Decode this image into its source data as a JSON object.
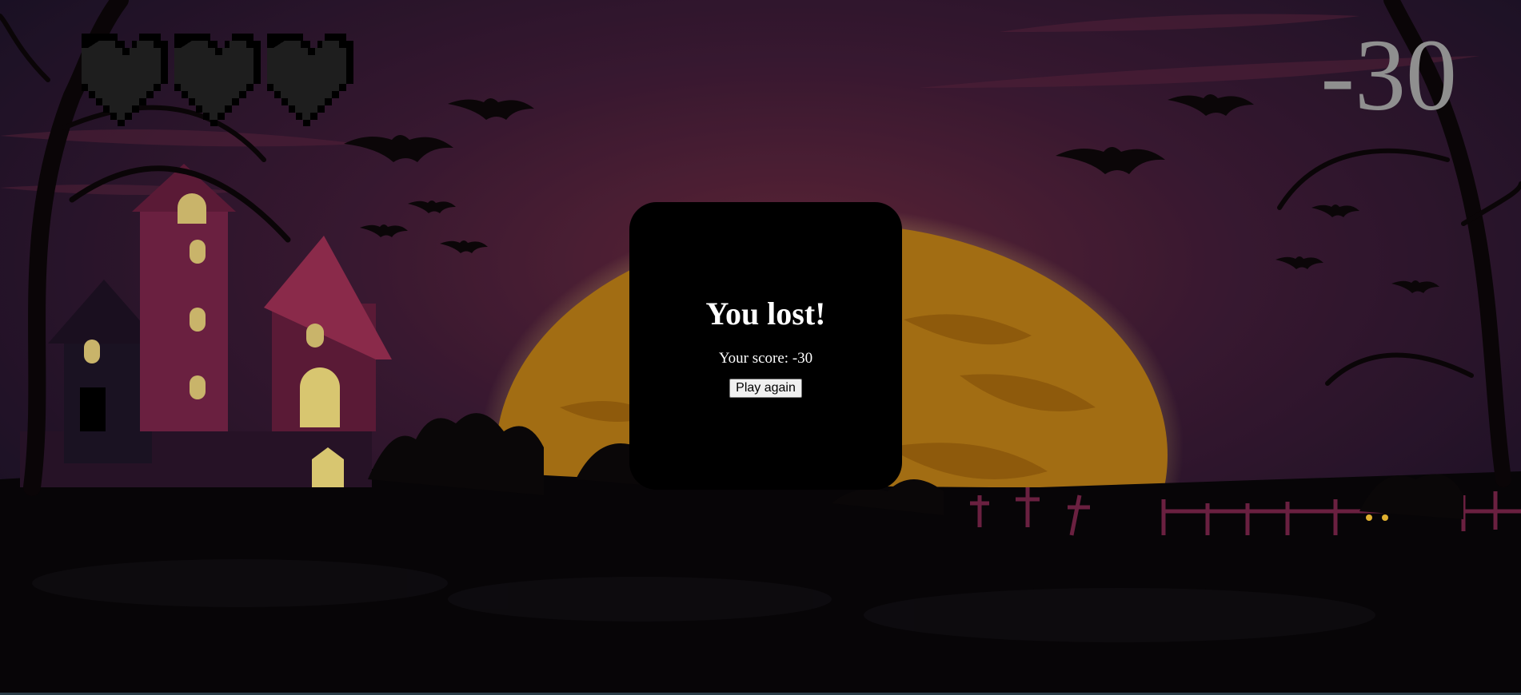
{
  "hud": {
    "lives_total": 3,
    "lives_remaining": 0,
    "score": "-30"
  },
  "dialog": {
    "title": "You lost!",
    "score_text": "Your score: -30",
    "play_again_label": "Play again"
  },
  "icons": {
    "life": "pixel-heart-icon"
  },
  "colors": {
    "sky_top": "#3a1c3c",
    "moon": "#e8a41c",
    "heart_empty": "#1e1e1e",
    "score_text": "#8f8f8f"
  }
}
